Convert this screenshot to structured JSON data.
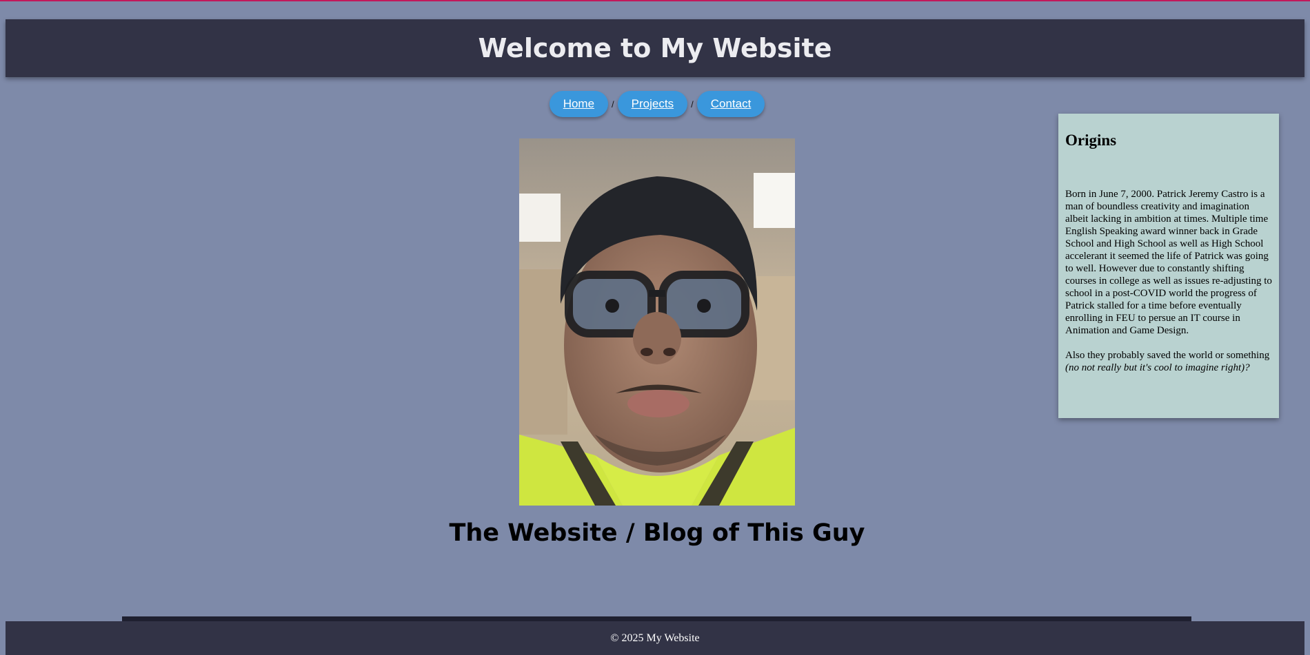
{
  "header": {
    "title": "Welcome to My Website"
  },
  "nav": {
    "items": [
      {
        "label": "Home"
      },
      {
        "label": "Projects"
      },
      {
        "label": "Contact"
      }
    ],
    "separator": "/"
  },
  "hero": {
    "subtitle": "The Website / Blog of This Guy"
  },
  "sidebar": {
    "title": "Origins",
    "paragraph1": "Born in June 7, 2000. Patrick Jeremy Castro is a man of boundless creativity and imagination albeit lacking in ambition at times. Multiple time English Speaking award winner back in Grade School and High School as well as High School accelerant it seemed the life of Patrick was going to well. However due to constantly shifting courses in college as well as issues re-adjusting to school in a post-COVID world the progress of Patrick stalled for a time before eventually enrolling in FEU to persue an IT course in Animation and Game Design.",
    "paragraph2_text": "Also they probably saved the world or something ",
    "paragraph2_italic": "(no not really but it's cool to imagine right)?"
  },
  "footer": {
    "text": "© 2025 My Website"
  },
  "colors": {
    "background": "#7e8aa9",
    "header": "#323346",
    "nav_button": "#3a97dc",
    "sidebar": "#b9d2d0",
    "top_border": "#c2185b"
  }
}
